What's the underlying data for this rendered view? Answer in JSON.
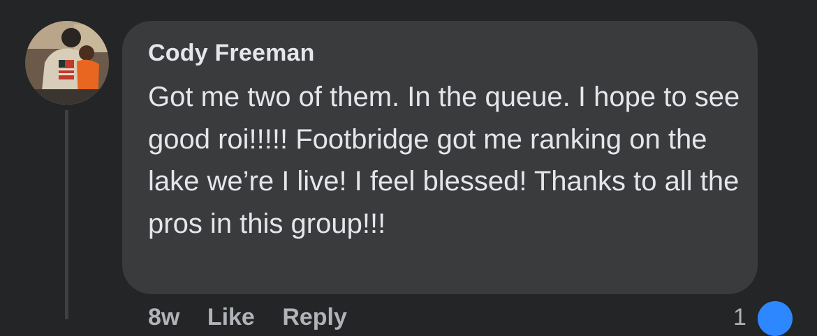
{
  "comment": {
    "author": "Cody Freeman",
    "text": "Got me two of them. In the queue. I hope to see good roi!!!!! Footbridge got me ranking on the lake we’re I live! I feel blessed! Thanks to all the pros in this group!!!"
  },
  "actions": {
    "time": "8w",
    "like_label": "Like",
    "reply_label": "Reply",
    "reaction_count": "1"
  },
  "icons": {
    "avatar": "profile-photo",
    "reaction": "thumbs-up-icon"
  },
  "colors": {
    "background": "#242526",
    "bubble": "#3a3b3c",
    "text": "#e4e6eb",
    "secondary_text": "#b0b3b8",
    "accent": "#2d88ff"
  }
}
